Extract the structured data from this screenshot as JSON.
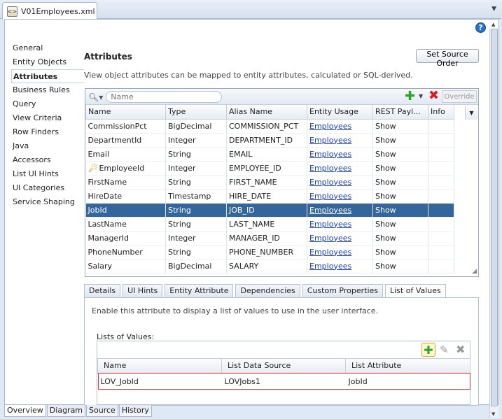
{
  "file_tab": {
    "title": "V01Employees.xml"
  },
  "nav": {
    "items": [
      {
        "label": "General"
      },
      {
        "label": "Entity Objects"
      },
      {
        "label": "Attributes",
        "selected": true
      },
      {
        "label": "Business Rules"
      },
      {
        "label": "Query"
      },
      {
        "label": "View Criteria"
      },
      {
        "label": "Row Finders"
      },
      {
        "label": "Java"
      },
      {
        "label": "Accessors"
      },
      {
        "label": "List UI Hints"
      },
      {
        "label": "UI Categories"
      },
      {
        "label": "Service Shaping"
      }
    ]
  },
  "attributes": {
    "title": "Attributes",
    "description": "View object attributes can be mapped to entity attributes, calculated or SQL-derived.",
    "set_source_order_label": "Set Source Order",
    "search_placeholder": "Name",
    "override_label": "Override",
    "columns": [
      "Name",
      "Type",
      "Alias Name",
      "Entity Usage",
      "REST Payl...",
      "Info"
    ],
    "rows": [
      [
        "CommissionPct",
        "BigDecimal",
        "COMMISSION_PCT",
        "Employees",
        "Show",
        ""
      ],
      [
        "DepartmentId",
        "Integer",
        "DEPARTMENT_ID",
        "Employees",
        "Show",
        ""
      ],
      [
        "Email",
        "String",
        "EMAIL",
        "Employees",
        "Show",
        ""
      ],
      [
        "EmployeeId",
        "Integer",
        "EMPLOYEE_ID",
        "Employees",
        "Show",
        ""
      ],
      [
        "FirstName",
        "String",
        "FIRST_NAME",
        "Employees",
        "Show",
        ""
      ],
      [
        "HireDate",
        "Timestamp",
        "HIRE_DATE",
        "Employees",
        "Show",
        ""
      ],
      [
        "JobId",
        "String",
        "JOB_ID",
        "Employees",
        "Show",
        ""
      ],
      [
        "LastName",
        "String",
        "LAST_NAME",
        "Employees",
        "Show",
        ""
      ],
      [
        "ManagerId",
        "Integer",
        "MANAGER_ID",
        "Employees",
        "Show",
        ""
      ],
      [
        "PhoneNumber",
        "String",
        "PHONE_NUMBER",
        "Employees",
        "Show",
        ""
      ],
      [
        "Salary",
        "BigDecimal",
        "SALARY",
        "Employees",
        "Show",
        ""
      ]
    ],
    "selected_row": "JobId",
    "key_row": "EmployeeId"
  },
  "detail_tabs": [
    {
      "label": "Details"
    },
    {
      "label": "UI Hints"
    },
    {
      "label": "Entity Attribute"
    },
    {
      "label": "Dependencies"
    },
    {
      "label": "Custom Properties"
    },
    {
      "label": "List of Values",
      "active": true
    }
  ],
  "lov": {
    "description": "Enable this attribute to display a list of values to use in the user interface.",
    "section_label": "Lists of Values:",
    "columns": [
      "Name",
      "List Data Source",
      "List Attribute"
    ],
    "rows": [
      [
        "LOV_JobId",
        "LOVJobs1",
        "JobId"
      ]
    ]
  },
  "bottom_tabs": [
    {
      "label": "Overview",
      "active": true
    },
    {
      "label": "Diagram"
    },
    {
      "label": "Source"
    },
    {
      "label": "History"
    }
  ],
  "colors": {
    "selection": "#35669b",
    "accent_link": "#1f3fb5",
    "add": "#2fa52f",
    "delete": "#d42020",
    "highlight_outline": "#d83434"
  }
}
